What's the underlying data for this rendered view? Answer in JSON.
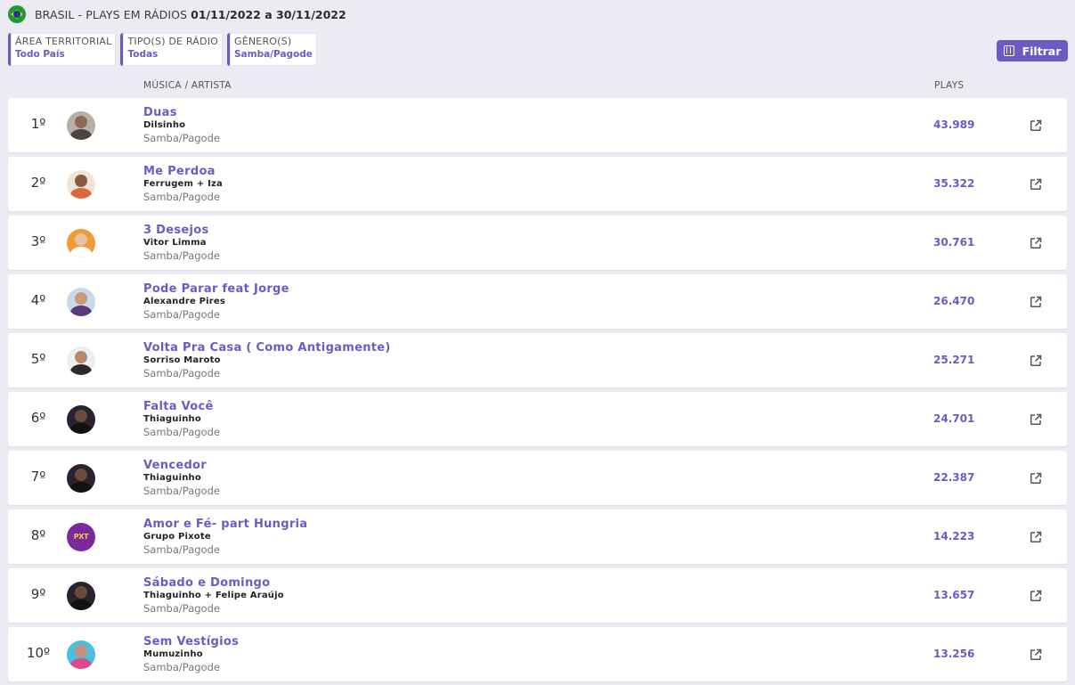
{
  "header": {
    "title": "BRASIL - PLAYS EM RÁDIOS",
    "dates": "01/11/2022 a 30/11/2022",
    "flag_icon": "brazil-flag-icon"
  },
  "filters": [
    {
      "label": "ÁREA TERRITORIAL",
      "value": "Todo País"
    },
    {
      "label": "TIPO(S) DE RÁDIO",
      "value": "Todas"
    },
    {
      "label": "GÊNERO(S)",
      "value": "Samba/Pagode"
    }
  ],
  "filter_button": {
    "label": "Filtrar",
    "icon": "sliders-icon"
  },
  "columns": {
    "music": "MÚSICA / ARTISTA",
    "plays": "PLAYS"
  },
  "colors": {
    "accent": "#6b5cc4",
    "background": "#ecebf3"
  },
  "rows": [
    {
      "rank": "1º",
      "song": "Duas",
      "artist": "Dilsinho",
      "genre": "Samba/Pagode",
      "plays": "43.989"
    },
    {
      "rank": "2º",
      "song": "Me Perdoa",
      "artist": "Ferrugem + Iza",
      "genre": "Samba/Pagode",
      "plays": "35.322"
    },
    {
      "rank": "3º",
      "song": "3 Desejos",
      "artist": "Vitor Limma",
      "genre": "Samba/Pagode",
      "plays": "30.761"
    },
    {
      "rank": "4º",
      "song": "Pode Parar feat Jorge",
      "artist": "Alexandre Pires",
      "genre": "Samba/Pagode",
      "plays": "26.470"
    },
    {
      "rank": "5º",
      "song": "Volta Pra Casa ( Como Antigamente)",
      "artist": "Sorriso Maroto",
      "genre": "Samba/Pagode",
      "plays": "25.271"
    },
    {
      "rank": "6º",
      "song": "Falta Você",
      "artist": "Thiaguinho",
      "genre": "Samba/Pagode",
      "plays": "24.701"
    },
    {
      "rank": "7º",
      "song": "Vencedor",
      "artist": "Thiaguinho",
      "genre": "Samba/Pagode",
      "plays": "22.387"
    },
    {
      "rank": "8º",
      "song": "Amor e Fé- part Hungria",
      "artist": "Grupo Pixote",
      "genre": "Samba/Pagode",
      "plays": "14.223",
      "avatar_text": "PXT"
    },
    {
      "rank": "9º",
      "song": "Sábado e Domingo",
      "artist": "Thiaguinho + Felipe Araújo",
      "genre": "Samba/Pagode",
      "plays": "13.657"
    },
    {
      "rank": "10º",
      "song": "Sem Vestígios",
      "artist": "Mumuzinho",
      "genre": "Samba/Pagode",
      "plays": "13.256"
    }
  ]
}
